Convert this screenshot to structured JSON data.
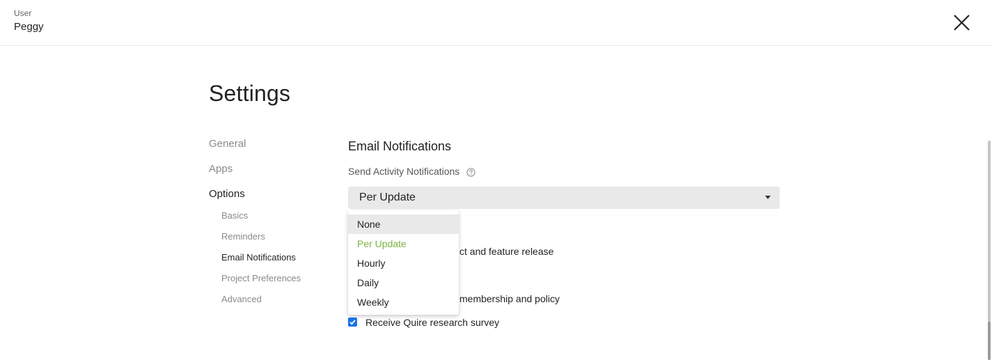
{
  "header": {
    "user_caption": "User",
    "user_name": "Peggy",
    "close_icon": "close-icon"
  },
  "page": {
    "title": "Settings"
  },
  "nav": {
    "items": [
      {
        "label": "General",
        "active": false
      },
      {
        "label": "Apps",
        "active": false
      },
      {
        "label": "Options",
        "active": true
      }
    ],
    "sub_items": [
      {
        "label": "Basics",
        "active": false
      },
      {
        "label": "Reminders",
        "active": false
      },
      {
        "label": "Email Notifications",
        "active": true
      },
      {
        "label": "Project Preferences",
        "active": false
      },
      {
        "label": "Advanced",
        "active": false
      }
    ]
  },
  "email_notifications": {
    "section_title": "Email Notifications",
    "activity_label": "Send Activity Notifications",
    "help_icon": "help-circle-icon",
    "activity_select": {
      "value": "Per Update",
      "caret_icon": "caret-down-icon",
      "options": [
        {
          "label": "None",
          "hovered": true,
          "selected": false
        },
        {
          "label": "Per Update",
          "hovered": false,
          "selected": true
        },
        {
          "label": "Hourly",
          "hovered": false,
          "selected": false
        },
        {
          "label": "Daily",
          "hovered": false,
          "selected": false
        },
        {
          "label": "Weekly",
          "hovered": false,
          "selected": false
        }
      ]
    },
    "obscured_option_1_tail": "ct and feature release",
    "obscured_option_2_tail": "membership and policy",
    "research_survey": {
      "label": "Receive Quire research survey",
      "checked": true
    }
  },
  "colors": {
    "accent_green": "#7cb342",
    "checkbox_blue": "#1a73e8",
    "select_bg": "#e9e9e9"
  }
}
